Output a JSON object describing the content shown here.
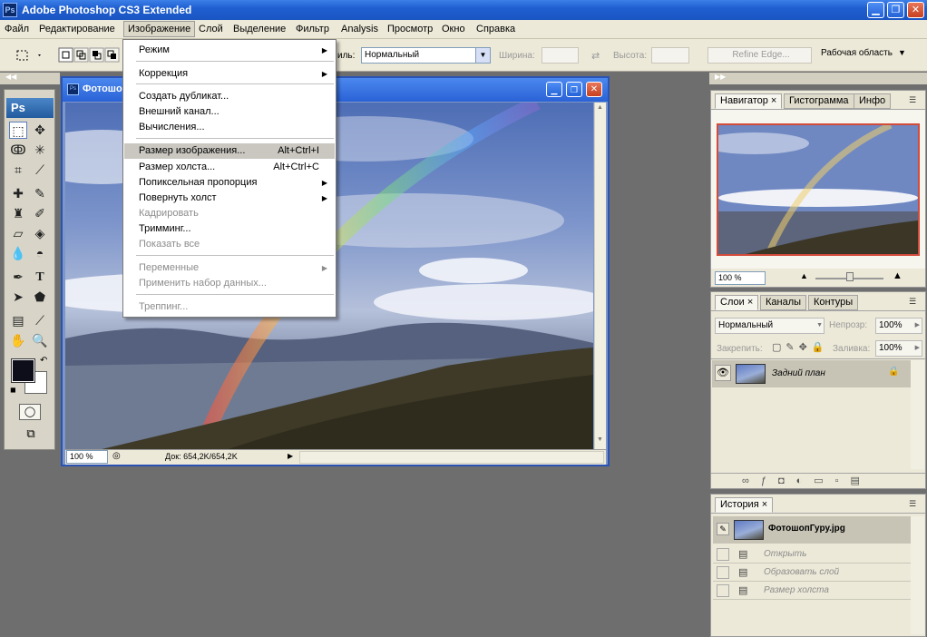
{
  "app": {
    "title": "Adobe Photoshop CS3 Extended",
    "logo": "Ps"
  },
  "window_buttons": {
    "minimize": "▁",
    "maximize": "❐",
    "close": "✕"
  },
  "menubar": [
    "Файл",
    "Редактирование",
    "Изображение",
    "Слой",
    "Выделение",
    "Фильтр",
    "Analysis",
    "Просмотр",
    "Окно",
    "Справка"
  ],
  "options": {
    "style_label": "иль:",
    "style_value": "Нормальный",
    "width_label": "Ширина:",
    "height_label": "Высота:",
    "refine_edge": "Refine Edge...",
    "workspace": "Рабочая область"
  },
  "toolbox": {
    "logo": "Ps"
  },
  "document": {
    "title": "Фотошо",
    "zoom": "100 %",
    "doc_info": "Док: 654,2K/654,2K"
  },
  "image_menu": {
    "items": [
      {
        "label": "Режим",
        "shortcut": "",
        "submenu": true,
        "disabled": false,
        "highlight": false
      },
      {
        "label": "Коррекция",
        "shortcut": "",
        "submenu": true,
        "disabled": false,
        "highlight": false
      },
      {
        "label": "Создать дубликат...",
        "shortcut": "",
        "submenu": false,
        "disabled": false,
        "highlight": false
      },
      {
        "label": "Внешний канал...",
        "shortcut": "",
        "submenu": false,
        "disabled": false,
        "highlight": false
      },
      {
        "label": "Вычисления...",
        "shortcut": "",
        "submenu": false,
        "disabled": false,
        "highlight": false
      },
      {
        "label": "Размер изображения...",
        "shortcut": "Alt+Ctrl+I",
        "submenu": false,
        "disabled": false,
        "highlight": true
      },
      {
        "label": "Размер холста...",
        "shortcut": "Alt+Ctrl+C",
        "submenu": false,
        "disabled": false,
        "highlight": false
      },
      {
        "label": "Попиксельная пропорция",
        "shortcut": "",
        "submenu": true,
        "disabled": false,
        "highlight": false
      },
      {
        "label": "Повернуть холст",
        "shortcut": "",
        "submenu": true,
        "disabled": false,
        "highlight": false
      },
      {
        "label": "Кадрировать",
        "shortcut": "",
        "submenu": false,
        "disabled": true,
        "highlight": false
      },
      {
        "label": "Тримминг...",
        "shortcut": "",
        "submenu": false,
        "disabled": false,
        "highlight": false
      },
      {
        "label": "Показать все",
        "shortcut": "",
        "submenu": false,
        "disabled": true,
        "highlight": false
      },
      {
        "label": "Переменные",
        "shortcut": "",
        "submenu": true,
        "disabled": true,
        "highlight": false
      },
      {
        "label": "Применить набор данных...",
        "shortcut": "",
        "submenu": false,
        "disabled": true,
        "highlight": false
      },
      {
        "label": "Треппинг...",
        "shortcut": "",
        "submenu": false,
        "disabled": true,
        "highlight": false
      }
    ]
  },
  "navigator": {
    "tabs": [
      "Навигатор",
      "Гистограмма",
      "Инфо"
    ],
    "zoom": "100 %"
  },
  "layers": {
    "tabs": [
      "Слои",
      "Каналы",
      "Контуры"
    ],
    "blend_mode": "Нормальный",
    "opacity_label": "Непрозр:",
    "opacity_value": "100%",
    "lock_label": "Закрепить:",
    "fill_label": "Заливка:",
    "fill_value": "100%",
    "layer_name": "Задний план"
  },
  "history": {
    "tabs": [
      "История"
    ],
    "snapshot": "ФотошопГуру.jpg",
    "items": [
      "Открыть",
      "Образовать слой",
      "Размер холста"
    ]
  },
  "colors": {
    "accent": "#2a62d6",
    "menu_bg": "#ece9d8",
    "workspace": "#6e6e6e"
  }
}
